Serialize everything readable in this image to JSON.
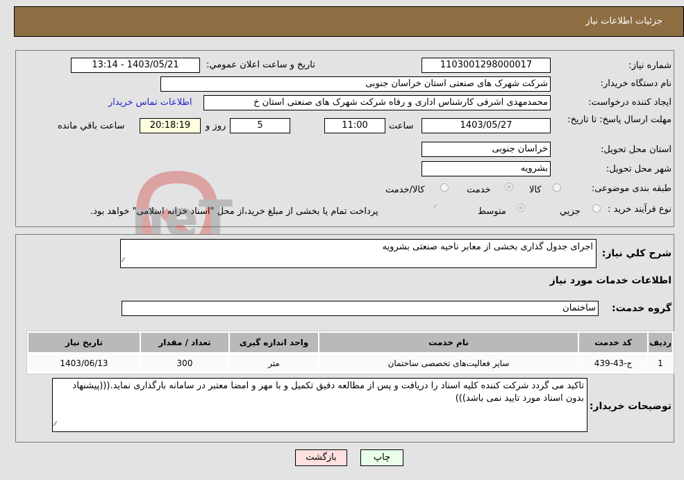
{
  "header": {
    "title": "جزئیات اطلاعات نیاز"
  },
  "details": {
    "need_number_label": "شماره نیاز:",
    "need_number": "1103001298000017",
    "announce_label": "تاریخ و ساعت اعلان عمومي:",
    "announce_value": "1403/05/21 - 13:14",
    "buyer_org_label": "نام دستگاه خریدار:",
    "buyer_org": "شرکت شهرک های صنعتی استان خراسان جنوبی",
    "creator_label": "ایجاد کننده درخواست:",
    "creator": "محمدمهدی اشرفی کارشناس اداری و رفاه شرکت شهرک های صنعتی استان خ",
    "contact_link": "اطلاعات تماس خریدار",
    "deadline_label": "مهلت ارسال پاسخ: تا تاریخ:",
    "deadline_date": "1403/05/27",
    "time_label": "ساعت",
    "deadline_time": "11:00",
    "days_value": "5",
    "days_label": "روز و",
    "remaining_time": "20:18:19",
    "remaining_label": "ساعت باقي مانده",
    "province_label": "استان محل تحویل:",
    "province": "خراسان جنوبی",
    "city_label": "شهر محل تحویل:",
    "city": "بشرویه",
    "category_label": "طبقه بندی موضوعی:",
    "category_options": [
      {
        "label": "کالا",
        "selected": false
      },
      {
        "label": "خدمت",
        "selected": true
      },
      {
        "label": "کالا/خدمت",
        "selected": false
      }
    ],
    "process_label": "نوع فرآیند خرید :",
    "process_options": [
      {
        "label": "جزيي",
        "selected": false
      },
      {
        "label": "متوسط",
        "selected": true
      }
    ],
    "payment_note": "پرداخت تمام یا بخشی از مبلغ خرید،از محل \"اسناد خزانه اسلامی\" خواهد بود."
  },
  "summary": {
    "desc_label": "شرح کلي نياز:",
    "desc_value": "اجرای جدول گذاری بخشی از معابر ناحیه صنعتی بشرویه",
    "services_title": "اطلاعات خدمات مورد نیاز",
    "group_label": "گروه خدمت:",
    "group_value": "ساختمان"
  },
  "table": {
    "headers": [
      "ردیف",
      "کد خدمت",
      "نام خدمت",
      "واحد اندازه گیری",
      "تعداد / مقدار",
      "تاریخ نیاز"
    ],
    "rows": [
      [
        "1",
        "ج-43-439",
        "سایر فعالیت‌های تخصصی ساختمان",
        "متر",
        "300",
        "1403/06/13"
      ]
    ]
  },
  "notes": {
    "label": "توضیحات خریدار:",
    "value": "تاکید می گردد شرکت کننده کلیه اسناد را دریافت و پس از مطالعه دقیق تکمیل و با مهر و امضا معتبر در سامانه بارگذاری نماید.(((پیشنهاد بدون اسناد مورد تایید نمی باشد)))"
  },
  "buttons": {
    "print": "چاپ",
    "back": "بازگشت"
  },
  "watermark": {
    "text": "AriaTender.neT"
  }
}
